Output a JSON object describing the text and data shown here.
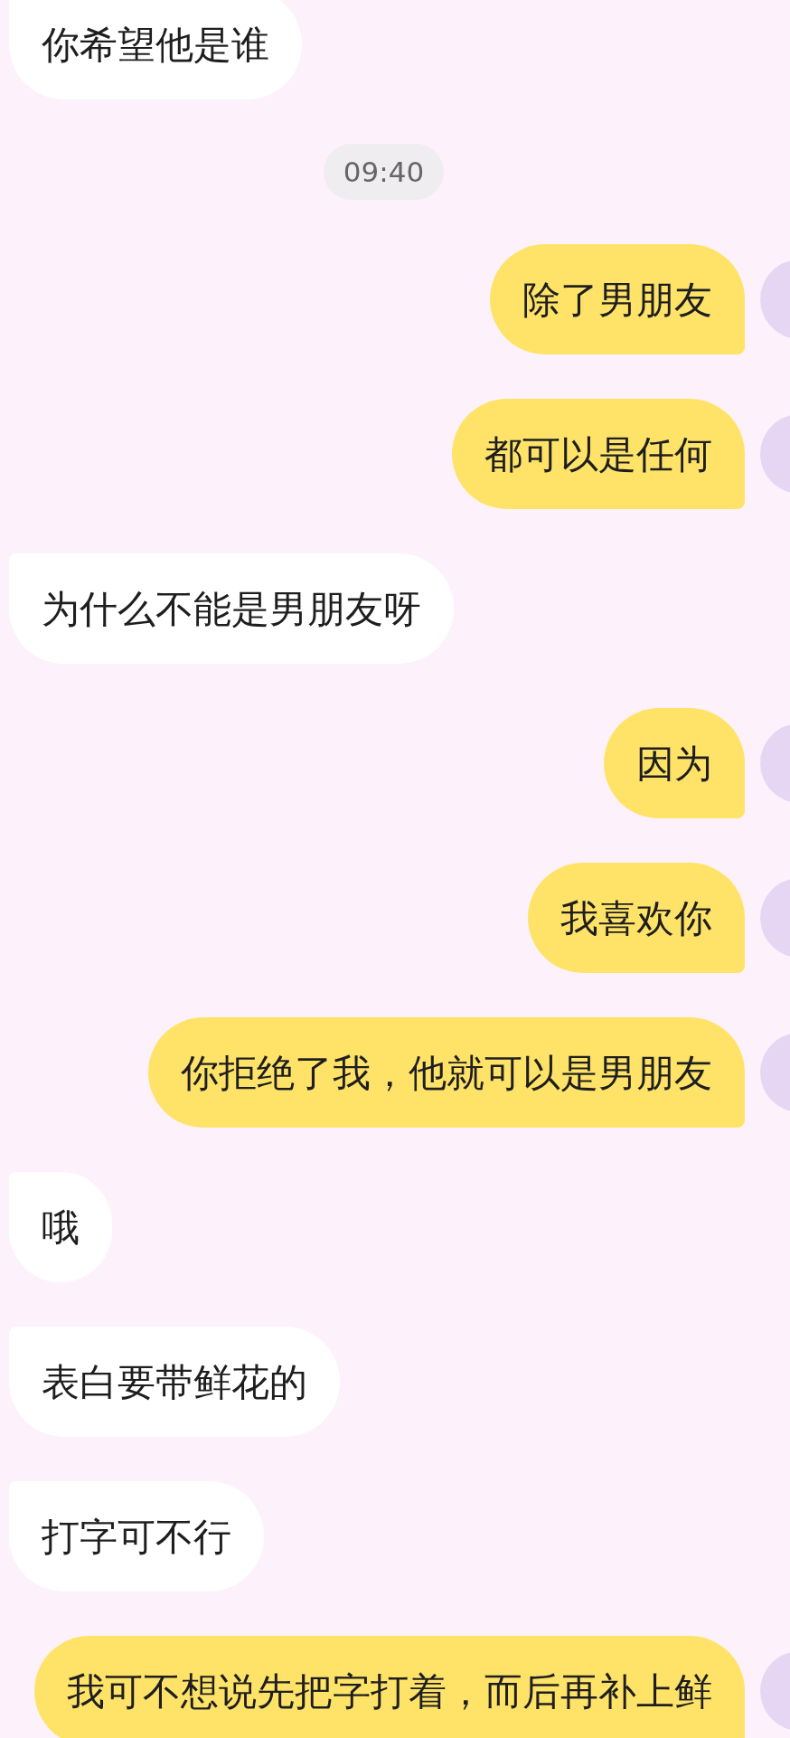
{
  "messages": [
    {
      "kind": "incoming",
      "text": "你希望他是谁"
    },
    {
      "kind": "time",
      "text": "09:40"
    },
    {
      "kind": "outgoing",
      "text": "除了男朋友"
    },
    {
      "kind": "outgoing",
      "text": "都可以是任何"
    },
    {
      "kind": "incoming",
      "text": "为什么不能是男朋友呀"
    },
    {
      "kind": "outgoing",
      "text": "因为"
    },
    {
      "kind": "outgoing",
      "text": "我喜欢你"
    },
    {
      "kind": "outgoing",
      "text": "你拒绝了我，他就可以是男朋友"
    },
    {
      "kind": "incoming",
      "text": "哦"
    },
    {
      "kind": "incoming",
      "text": "表白要带鲜花的"
    },
    {
      "kind": "incoming",
      "text": "打字可不行"
    },
    {
      "kind": "outgoing",
      "text": "我可不想说先把字打着，而后再补上鲜"
    }
  ]
}
